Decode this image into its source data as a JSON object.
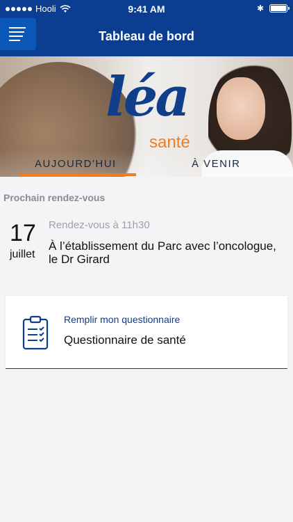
{
  "status_bar": {
    "carrier": "Hooli",
    "time": "9:41 AM"
  },
  "nav": {
    "title": "Tableau de bord"
  },
  "hero": {
    "logo_main": "léa",
    "logo_sub": "santé",
    "tabs": [
      {
        "label": "AUJOURD'HUI",
        "active": true
      },
      {
        "label": "À VENIR",
        "active": false
      }
    ]
  },
  "appointments": {
    "section_title": "Prochain rendez-vous",
    "day": "17",
    "month": "juillet",
    "time_text": "Rendez-vous à 11h30",
    "description": "À l’établissement du Parc avec l’oncologue, le Dr Girard"
  },
  "card": {
    "icon": "clipboard-checklist-icon",
    "link_text": "Remplir mon questionnaire",
    "title": "Questionnaire de santé"
  },
  "colors": {
    "primary": "#0b3d91",
    "accent": "#ee7d22",
    "muted": "#8a8a92"
  }
}
